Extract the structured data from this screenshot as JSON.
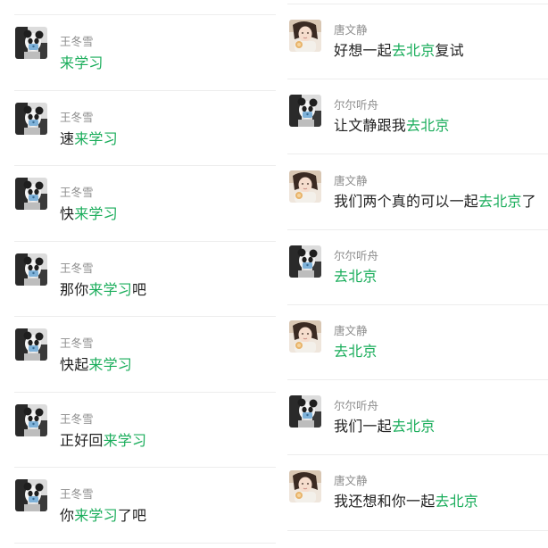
{
  "colors": {
    "highlight": "#1aad5b",
    "text": "#222222",
    "name": "#8c8c8c",
    "divider": "#ededed"
  },
  "left_results": [
    {
      "name": "王冬雪",
      "avatar": "panda-avatar",
      "parts": [
        {
          "text": "来学习",
          "hl": true
        }
      ]
    },
    {
      "name": "王冬雪",
      "avatar": "panda-avatar",
      "parts": [
        {
          "text": "速",
          "hl": false
        },
        {
          "text": "来学习",
          "hl": true
        }
      ]
    },
    {
      "name": "王冬雪",
      "avatar": "panda-avatar",
      "parts": [
        {
          "text": "快",
          "hl": false
        },
        {
          "text": "来学习",
          "hl": true
        }
      ]
    },
    {
      "name": "王冬雪",
      "avatar": "panda-avatar",
      "parts": [
        {
          "text": "那你",
          "hl": false
        },
        {
          "text": "来学习",
          "hl": true
        },
        {
          "text": "吧",
          "hl": false
        }
      ]
    },
    {
      "name": "王冬雪",
      "avatar": "panda-avatar",
      "parts": [
        {
          "text": "快起",
          "hl": false
        },
        {
          "text": "来学习",
          "hl": true
        }
      ]
    },
    {
      "name": "王冬雪",
      "avatar": "panda-avatar",
      "parts": [
        {
          "text": "正好回",
          "hl": false
        },
        {
          "text": "来学习",
          "hl": true
        }
      ]
    },
    {
      "name": "王冬雪",
      "avatar": "panda-avatar",
      "parts": [
        {
          "text": "你",
          "hl": false
        },
        {
          "text": "来学习",
          "hl": true
        },
        {
          "text": "了吧",
          "hl": false
        }
      ]
    }
  ],
  "right_results": [
    {
      "name": "唐文静",
      "avatar": "girl-avatar",
      "parts": [
        {
          "text": "好想一起",
          "hl": false
        },
        {
          "text": "去北京",
          "hl": true
        },
        {
          "text": "复试",
          "hl": false
        }
      ]
    },
    {
      "name": "尔尔听舟",
      "avatar": "panda-avatar",
      "parts": [
        {
          "text": "让文静跟我",
          "hl": false
        },
        {
          "text": "去北京",
          "hl": true
        }
      ]
    },
    {
      "name": "唐文静",
      "avatar": "girl-avatar",
      "parts": [
        {
          "text": "我们两个真的可以一起",
          "hl": false
        },
        {
          "text": "去北京",
          "hl": true
        },
        {
          "text": "了",
          "hl": false
        }
      ]
    },
    {
      "name": "尔尔听舟",
      "avatar": "panda-avatar",
      "parts": [
        {
          "text": "去北京",
          "hl": true
        }
      ]
    },
    {
      "name": "唐文静",
      "avatar": "girl-avatar",
      "parts": [
        {
          "text": "去北京",
          "hl": true
        }
      ]
    },
    {
      "name": "尔尔听舟",
      "avatar": "panda-avatar",
      "parts": [
        {
          "text": "我们一起",
          "hl": false
        },
        {
          "text": "去北京",
          "hl": true
        }
      ]
    },
    {
      "name": "唐文静",
      "avatar": "girl-avatar",
      "parts": [
        {
          "text": "我还想和你一起",
          "hl": false
        },
        {
          "text": "去北京",
          "hl": true
        }
      ]
    }
  ]
}
